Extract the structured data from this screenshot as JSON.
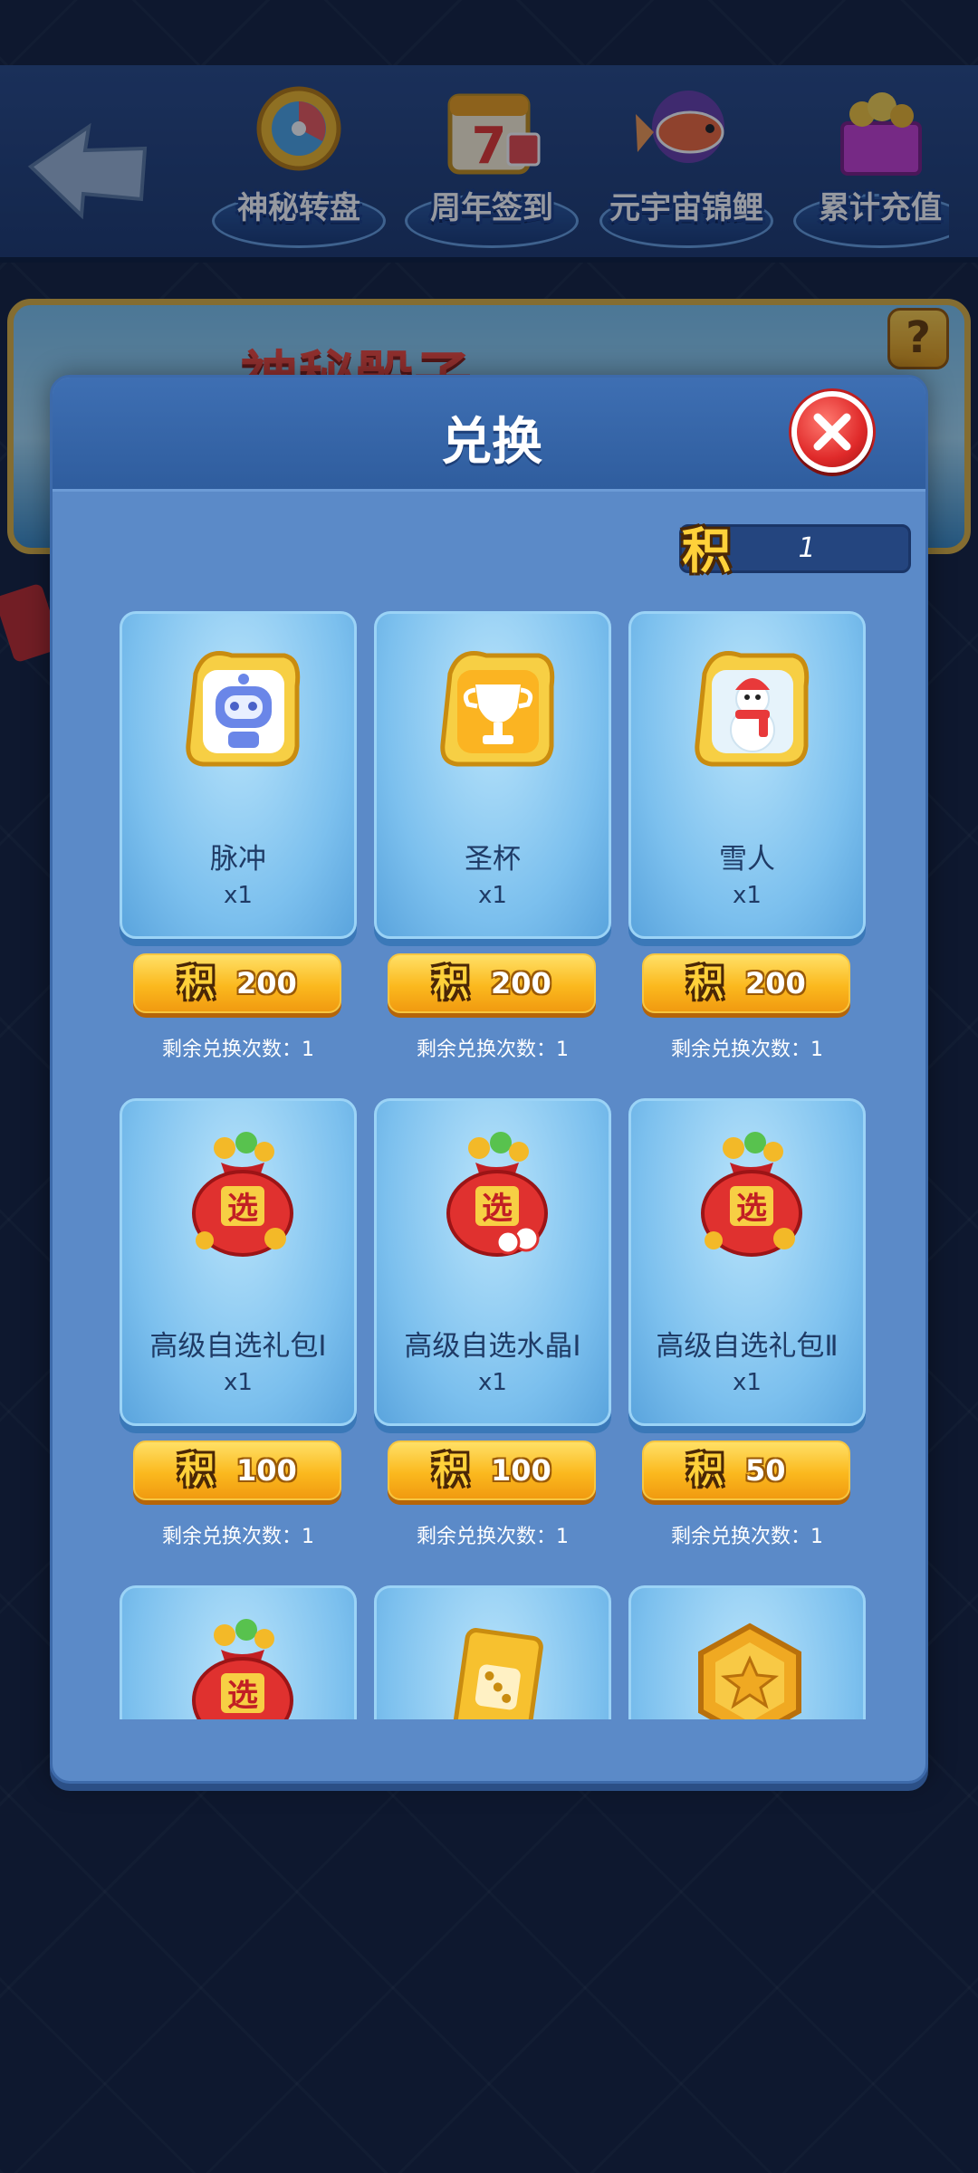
{
  "top_tabs": [
    {
      "label": "神秘转盘",
      "icon": "wheel-icon"
    },
    {
      "label": "周年签到",
      "icon": "calendar-icon"
    },
    {
      "label": "元宇宙锦鲤",
      "icon": "koi-fish-icon"
    },
    {
      "label": "累计充值",
      "icon": "gift-box-icon"
    }
  ],
  "banner": {
    "title": "神秘骰子"
  },
  "modal": {
    "title": "兑换",
    "points_icon": "积",
    "points_value": "1"
  },
  "items": [
    {
      "name": "脉冲",
      "qty": "x1",
      "cost_icon": "积",
      "cost": "200",
      "remaining": "剩余兑换次数：1",
      "icon": "robot-avatar-icon"
    },
    {
      "name": "圣杯",
      "qty": "x1",
      "cost_icon": "积",
      "cost": "200",
      "remaining": "剩余兑换次数：1",
      "icon": "trophy-avatar-icon"
    },
    {
      "name": "雪人",
      "qty": "x1",
      "cost_icon": "积",
      "cost": "200",
      "remaining": "剩余兑换次数：1",
      "icon": "snowman-avatar-icon"
    },
    {
      "name": "高级自选礼包Ⅰ",
      "qty": "x1",
      "cost_icon": "积",
      "cost": "100",
      "remaining": "剩余兑换次数：1",
      "icon": "lucky-bag-icon",
      "bag_char": "选"
    },
    {
      "name": "高级自选水晶Ⅰ",
      "qty": "x1",
      "cost_icon": "积",
      "cost": "100",
      "remaining": "剩余兑换次数：1",
      "icon": "lucky-bag-icon",
      "bag_char": "选"
    },
    {
      "name": "高级自选礼包Ⅱ",
      "qty": "x1",
      "cost_icon": "积",
      "cost": "50",
      "remaining": "剩余兑换次数：1",
      "icon": "lucky-bag-icon",
      "bag_char": "选"
    },
    {
      "icon": "lucky-bag-icon",
      "bag_char": "选"
    },
    {
      "icon": "dice-card-icon"
    },
    {
      "icon": "star-coin-icon"
    }
  ],
  "colors": {
    "modal_bg": "#5b8ac8",
    "card_bg": "#7cc0ee",
    "cost_button": "#fbb91e",
    "close_button": "#e02a2a"
  }
}
